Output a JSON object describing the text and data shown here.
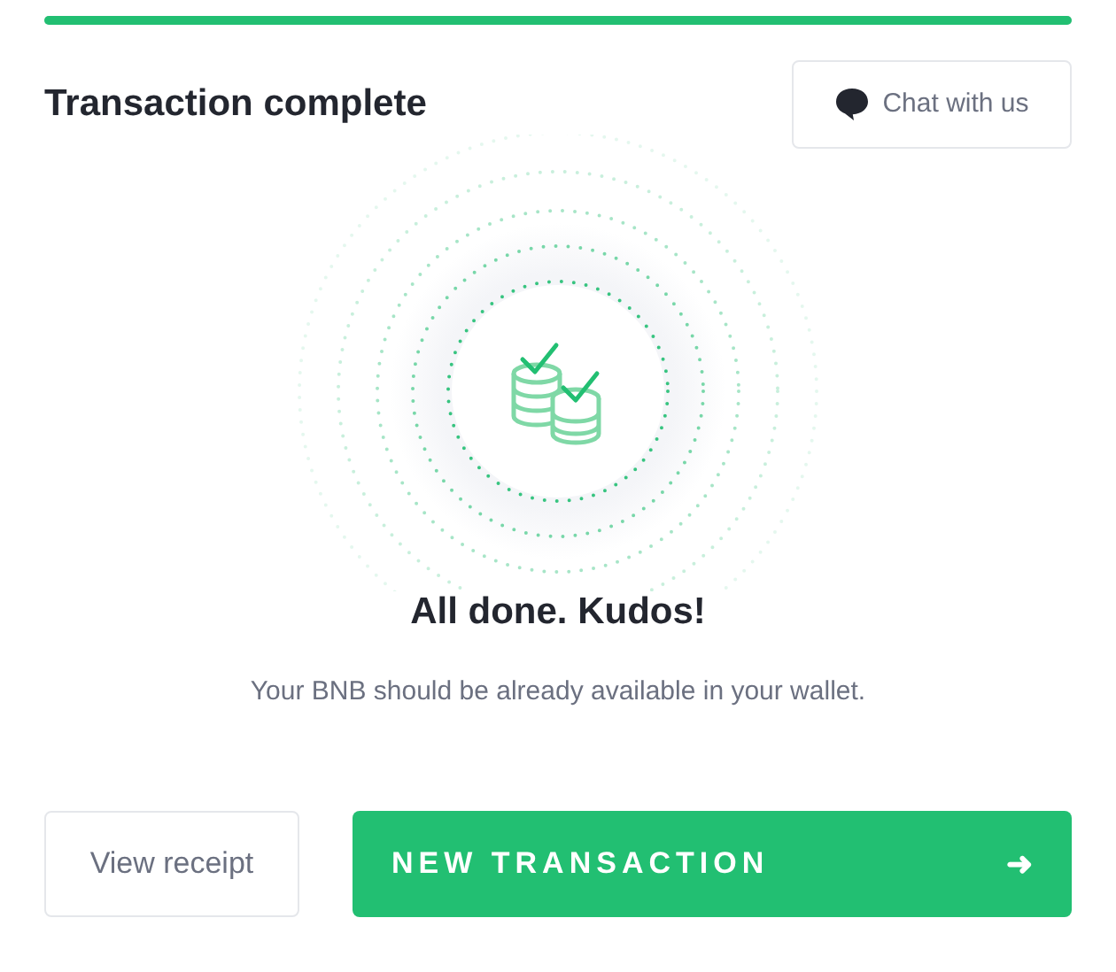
{
  "progress": {
    "level": 1
  },
  "header": {
    "title": "Transaction complete",
    "chat_button": "Chat with us"
  },
  "result": {
    "heading": "All done. Kudos!",
    "message": "Your BNB should be already available in your wallet."
  },
  "actions": {
    "secondary": "View receipt",
    "primary": "NEW TRANSACTION",
    "primary_arrow": "➜"
  }
}
